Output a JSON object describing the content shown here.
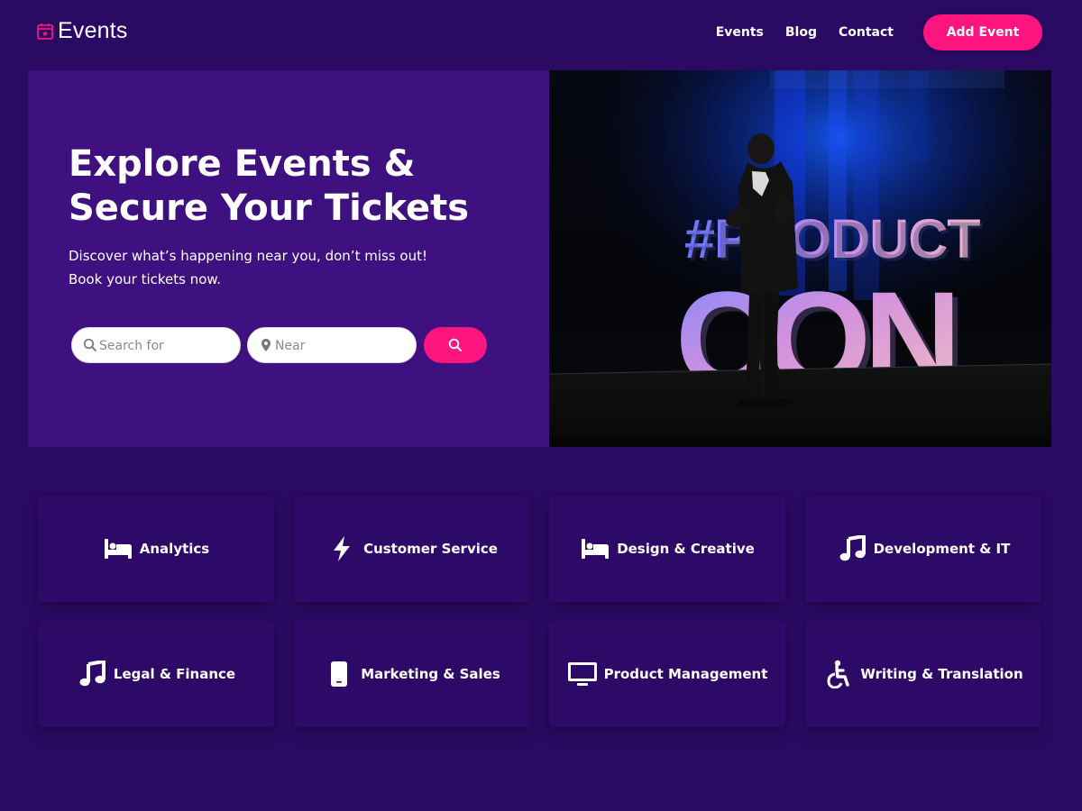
{
  "brand": {
    "name": "Events",
    "icon": "calendar-star-icon",
    "accent": "#ff157f"
  },
  "nav": {
    "items": [
      {
        "label": "Events"
      },
      {
        "label": "Blog"
      },
      {
        "label": "Contact"
      }
    ],
    "cta_label": "Add Event"
  },
  "hero": {
    "title_line_1": "Explore Events &",
    "title_line_2": "Secure Your Tickets",
    "subtitle": "Discover what’s happening near you, don’t miss out! Book your tickets now.",
    "search": {
      "placeholder": "Search for",
      "value": "",
      "icon": "search-icon"
    },
    "near": {
      "placeholder": "Near",
      "value": "",
      "icon": "map-pin-icon"
    },
    "search_button_icon": "search-icon",
    "image": {
      "icon": "stage-photo"
    }
  },
  "categories": [
    {
      "label": "Analytics",
      "icon": "bed-icon"
    },
    {
      "label": "Customer Service",
      "icon": "lightning-icon"
    },
    {
      "label": "Design & Creative",
      "icon": "bed-icon"
    },
    {
      "label": "Development & IT",
      "icon": "music-note-icon"
    },
    {
      "label": "Legal & Finance",
      "icon": "music-note-icon"
    },
    {
      "label": "Marketing & Sales",
      "icon": "mobile-phone-icon"
    },
    {
      "label": "Product Management",
      "icon": "desktop-icon"
    },
    {
      "label": "Writing & Translation",
      "icon": "wheelchair-icon"
    }
  ],
  "colors": {
    "page_bg": "#2a0a62",
    "hero_panel": "#3e1080",
    "card_bg": "#2d0a67",
    "cta": "#ff157f",
    "text": "#ffffff"
  }
}
